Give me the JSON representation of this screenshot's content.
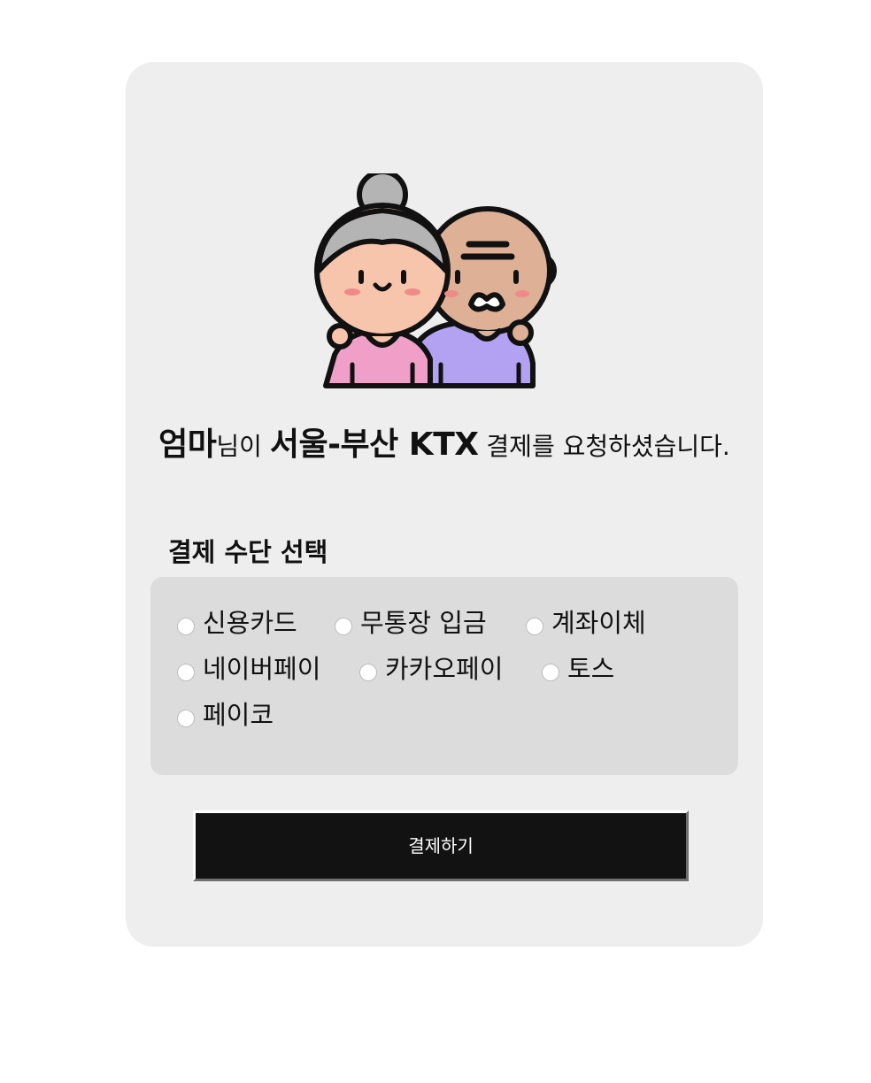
{
  "headline": {
    "requester": "엄마",
    "honorific": "님이",
    "item": "서울-부산 KTX",
    "message": "결제를 요청하셨습니다."
  },
  "payment": {
    "section_title": "결제 수단 선택",
    "options": [
      "신용카드",
      "무통장 입금",
      "계좌이체",
      "네이버페이",
      "카카오페이",
      "토스",
      "페이코"
    ],
    "selected": null
  },
  "button": {
    "label": "결제하기"
  },
  "illustration": {
    "icon": "elderly-couple-icon"
  },
  "colors": {
    "card_background": "#eeeeee",
    "options_background": "#dcdcdc",
    "button_background": "#121212",
    "button_text": "#ffffff",
    "grandma_shirt": "#f0a0c8",
    "grandpa_shirt": "#b3a2f2",
    "grandma_skin": "#f6c5ab",
    "grandpa_skin": "#deb095",
    "hair": "#b4b4b4",
    "cheeks": "#f08a8a"
  }
}
